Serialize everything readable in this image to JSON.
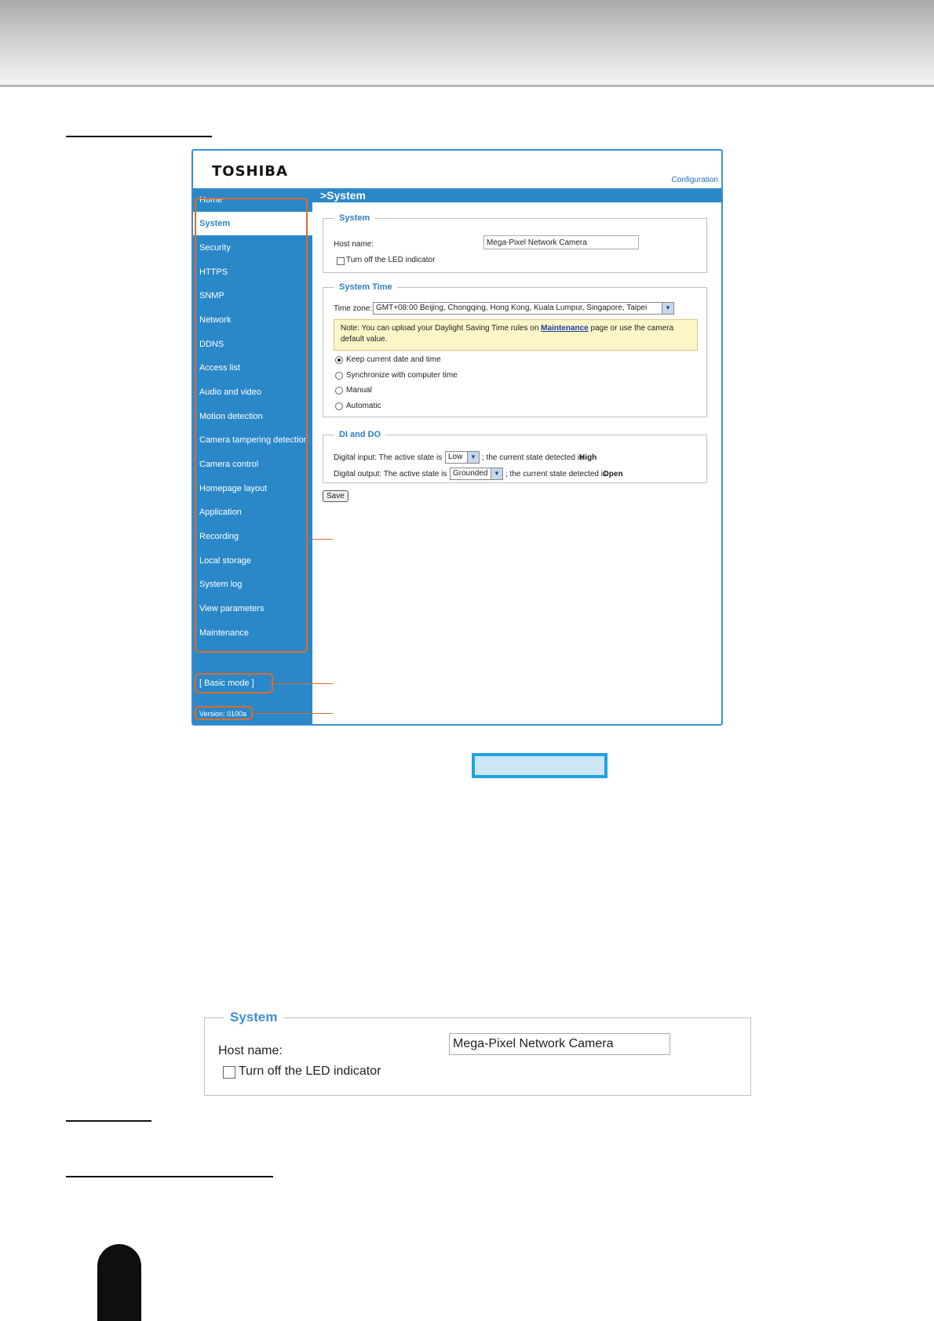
{
  "app": {
    "logo": "TOSHIBA",
    "configuration_link": "Configuration",
    "page_title": ">System"
  },
  "sidebar": {
    "items": [
      {
        "label": "Home"
      },
      {
        "label": "System"
      },
      {
        "label": "Security"
      },
      {
        "label": "HTTPS"
      },
      {
        "label": "SNMP"
      },
      {
        "label": "Network"
      },
      {
        "label": "DDNS"
      },
      {
        "label": "Access list"
      },
      {
        "label": "Audio and video"
      },
      {
        "label": "Motion detection"
      },
      {
        "label": "Camera tampering detection"
      },
      {
        "label": "Camera control"
      },
      {
        "label": "Homepage layout"
      },
      {
        "label": "Application"
      },
      {
        "label": "Recording"
      },
      {
        "label": "Local storage"
      },
      {
        "label": "System log"
      },
      {
        "label": "View parameters"
      },
      {
        "label": "Maintenance"
      }
    ],
    "active": "System",
    "basic_mode": "[ Basic mode ]",
    "version": "Version: 0100a"
  },
  "system_section": {
    "legend": "System",
    "host_name_label": "Host name:",
    "host_name_value": "Mega-Pixel Network Camera",
    "led_label": "Turn off the LED indicator"
  },
  "time_section": {
    "legend": "System Time",
    "time_zone_label": "Time zone:",
    "time_zone_value": "GMT+08:00 Beijing, Chongqing, Hong Kong, Kuala Lumpur, Singapore, Taipei",
    "note_prefix": "Note: You can upload your Daylight Saving Time rules on",
    "note_link": "Maintenance",
    "note_suffix": "page or use the camera default value.",
    "options": [
      {
        "label": "Keep current date and time",
        "checked": true
      },
      {
        "label": "Synchronize with computer time",
        "checked": false
      },
      {
        "label": "Manual",
        "checked": false
      },
      {
        "label": "Automatic",
        "checked": false
      }
    ]
  },
  "dido_section": {
    "legend": "DI and DO",
    "di_label": "Digital input: The active state is",
    "di_value": "Low",
    "di_state_text": "; the current state detected is",
    "di_state": "High",
    "do_label": "Digital output: The active state is",
    "do_value": "Grounded",
    "do_state_text": "; the current state detected is",
    "do_state": "Open"
  },
  "save_button": "Save",
  "zoomed_panel": {
    "legend": "System",
    "host_name_label": "Host name:",
    "host_name_value": "Mega-Pixel Network Camera",
    "led_label": "Turn off the LED indicator"
  },
  "colors": {
    "sidebar_blue": "#2a88c9",
    "callout_orange": "#e06a2a",
    "caption_cyan": "#1fa3e0"
  }
}
